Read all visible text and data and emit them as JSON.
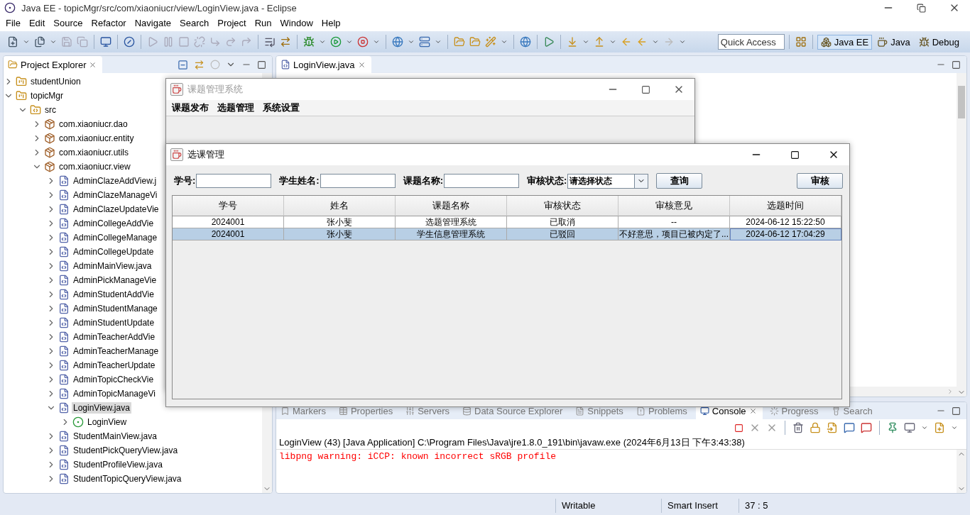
{
  "eclipse": {
    "title": "Java EE - topicMgr/src/com/xiaoniucr/view/LoginView.java - Eclipse",
    "menu": [
      "File",
      "Edit",
      "Source",
      "Refactor",
      "Navigate",
      "Search",
      "Project",
      "Run",
      "Window",
      "Help"
    ],
    "quick_access": {
      "placeholder": "Quick Access"
    },
    "perspectives": [
      {
        "label": "Java EE",
        "selected": true
      },
      {
        "label": "Java",
        "selected": false
      },
      {
        "label": "Debug",
        "selected": false
      }
    ]
  },
  "project_explorer": {
    "title": "Project Explorer",
    "tree": [
      {
        "label": "studentUnion",
        "kind": "project",
        "expanded": false,
        "selected": false
      },
      {
        "label": "topicMgr",
        "kind": "project",
        "expanded": true,
        "selected": false,
        "children": [
          {
            "label": "src",
            "kind": "source",
            "expanded": true,
            "selected": false,
            "children": [
              {
                "label": "com.xiaoniucr.dao",
                "kind": "package",
                "expanded": false,
                "selected": false
              },
              {
                "label": "com.xiaoniucr.entity",
                "kind": "package",
                "expanded": false,
                "selected": false
              },
              {
                "label": "com.xiaoniucr.utils",
                "kind": "package",
                "expanded": false,
                "selected": false
              },
              {
                "label": "com.xiaoniucr.view",
                "kind": "package",
                "expanded": true,
                "selected": false,
                "children": [
                  {
                    "label": "AdminClazeAddView.j",
                    "kind": "file",
                    "expanded": false,
                    "selected": false
                  },
                  {
                    "label": "AdminClazeManageVi",
                    "kind": "file",
                    "expanded": false,
                    "selected": false
                  },
                  {
                    "label": "AdminClazeUpdateVie",
                    "kind": "file",
                    "expanded": false,
                    "selected": false
                  },
                  {
                    "label": "AdminCollegeAddVie",
                    "kind": "file",
                    "expanded": false,
                    "selected": false
                  },
                  {
                    "label": "AdminCollegeManage",
                    "kind": "file",
                    "expanded": false,
                    "selected": false
                  },
                  {
                    "label": "AdminCollegeUpdate",
                    "kind": "file",
                    "expanded": false,
                    "selected": false
                  },
                  {
                    "label": "AdminMainView.java",
                    "kind": "file",
                    "expanded": false,
                    "selected": false
                  },
                  {
                    "label": "AdminPickManageVie",
                    "kind": "file",
                    "expanded": false,
                    "selected": false
                  },
                  {
                    "label": "AdminStudentAddVie",
                    "kind": "file",
                    "expanded": false,
                    "selected": false
                  },
                  {
                    "label": "AdminStudentManage",
                    "kind": "file",
                    "expanded": false,
                    "selected": false
                  },
                  {
                    "label": "AdminStudentUpdate",
                    "kind": "file",
                    "expanded": false,
                    "selected": false
                  },
                  {
                    "label": "AdminTeacherAddVie",
                    "kind": "file",
                    "expanded": false,
                    "selected": false
                  },
                  {
                    "label": "AdminTeacherManage",
                    "kind": "file",
                    "expanded": false,
                    "selected": false
                  },
                  {
                    "label": "AdminTeacherUpdate",
                    "kind": "file",
                    "expanded": false,
                    "selected": false
                  },
                  {
                    "label": "AdminTopicCheckVie",
                    "kind": "file",
                    "expanded": false,
                    "selected": false
                  },
                  {
                    "label": "AdminTopicManageVi",
                    "kind": "file",
                    "expanded": false,
                    "selected": false
                  },
                  {
                    "label": "LoginView.java",
                    "kind": "file",
                    "expanded": true,
                    "selected": true,
                    "children": [
                      {
                        "label": "LoginView",
                        "kind": "class",
                        "expanded": false,
                        "selected": false
                      }
                    ]
                  },
                  {
                    "label": "StudentMainView.java",
                    "kind": "file",
                    "expanded": false,
                    "selected": false
                  },
                  {
                    "label": "StudentPickQueryView.java",
                    "kind": "file",
                    "expanded": false,
                    "selected": false
                  },
                  {
                    "label": "StudentProfileView.java",
                    "kind": "file",
                    "expanded": false,
                    "selected": false
                  },
                  {
                    "label": "StudentTopicQueryView.java",
                    "kind": "file",
                    "expanded": false,
                    "selected": false
                  }
                ]
              }
            ]
          }
        ]
      }
    ]
  },
  "editor": {
    "tabs": [
      {
        "label": "LoginView.java",
        "selected": true
      }
    ]
  },
  "bottom_panel": {
    "tabs": [
      {
        "label": "Markers",
        "selected": false
      },
      {
        "label": "Properties",
        "selected": false
      },
      {
        "label": "Servers",
        "selected": false
      },
      {
        "label": "Data Source Explorer",
        "selected": false
      },
      {
        "label": "Snippets",
        "selected": false
      },
      {
        "label": "Problems",
        "selected": false
      },
      {
        "label": "Console",
        "selected": true
      },
      {
        "label": "Progress",
        "selected": false
      },
      {
        "label": "Search",
        "selected": false
      }
    ],
    "console": {
      "header": "LoginView (43) [Java Application] C:\\Program Files\\Java\\jre1.8.0_191\\bin\\javaw.exe (2024年6月13日 下午3:43:38)",
      "lines": [
        "libpng warning: iCCP: known incorrect sRGB profile"
      ]
    }
  },
  "status_bar": [
    "Writable",
    "Smart Insert",
    "37 : 5"
  ],
  "app_window": {
    "title": "课题管理系统",
    "active": false,
    "menu": [
      "课题发布",
      "选题管理",
      "系统设置"
    ]
  },
  "dialog": {
    "title": "选课管理",
    "active": true,
    "filters": [
      {
        "kind": "text",
        "label": "学号:"
      },
      {
        "kind": "text",
        "label": "学生姓名:"
      },
      {
        "kind": "text",
        "label": "课题名称:"
      },
      {
        "kind": "select",
        "label": "审核状态:",
        "value": "请选择状态"
      }
    ],
    "buttons": [
      "查询",
      "审核"
    ],
    "table": {
      "columns": [
        "学号",
        "姓名",
        "课题名称",
        "审核状态",
        "审核意见",
        "选题时间"
      ],
      "rows": [
        {
          "cells": [
            "2024001",
            "张小斐",
            "选题管理系统",
            "已取消",
            "--",
            "2024-06-12 15:22:50"
          ],
          "selected": false
        },
        {
          "cells": [
            "2024001",
            "张小斐",
            "学生信息管理系统",
            "已驳回",
            "不好意思，项目已被内定了...",
            "2024-06-12 17:04:29"
          ],
          "selected": true
        }
      ]
    }
  }
}
